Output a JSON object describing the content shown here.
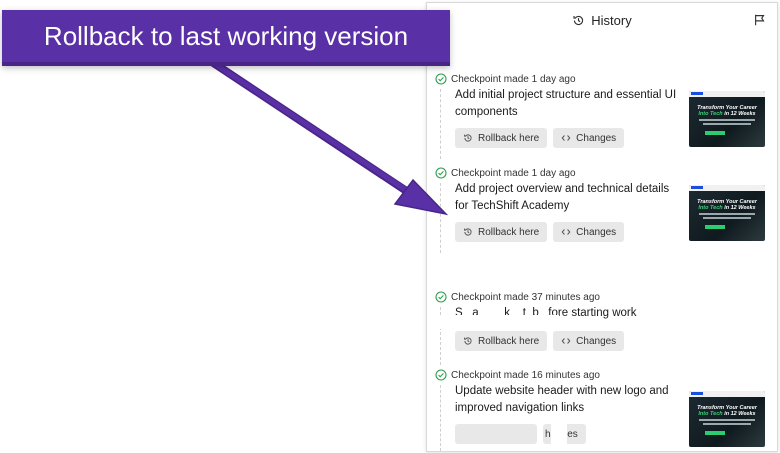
{
  "banner": {
    "text": "Rollback to last working version"
  },
  "panel": {
    "title": "History",
    "title_icon": "history-icon",
    "action_icon": "share-icon"
  },
  "checkpoints": [
    {
      "meta": "Checkpoint made 1 day ago",
      "title": "Add initial project structure and essential UI components",
      "rollback_label": "Rollback here",
      "changes_label": "Changes",
      "has_thumbnail": true
    },
    {
      "meta": "Checkpoint made 1 day ago",
      "title": "Add project overview and technical details for TechShift Academy",
      "rollback_label": "Rollback here",
      "changes_label": "Changes",
      "has_thumbnail": true
    },
    {
      "meta": "Checkpoint made 37 minutes ago",
      "title": "S   a        k    t  b   fore starting work",
      "rollback_label": "Rollback here",
      "changes_label": "Changes",
      "has_thumbnail": false
    },
    {
      "meta": "Checkpoint made 16 minutes ago",
      "title": "Update website header with new logo and improved navigation links",
      "rollback_label": "",
      "changes_label": "hanges",
      "has_thumbnail": true
    }
  ],
  "thumbnail": {
    "headline_white": "Transform Your Career",
    "headline_green": "Into Tech",
    "headline_tail": "in 12 Weeks"
  },
  "colors": {
    "banner": "#5a30a6",
    "check": "#2e9e4f",
    "button_bg": "#e8e8e8"
  }
}
